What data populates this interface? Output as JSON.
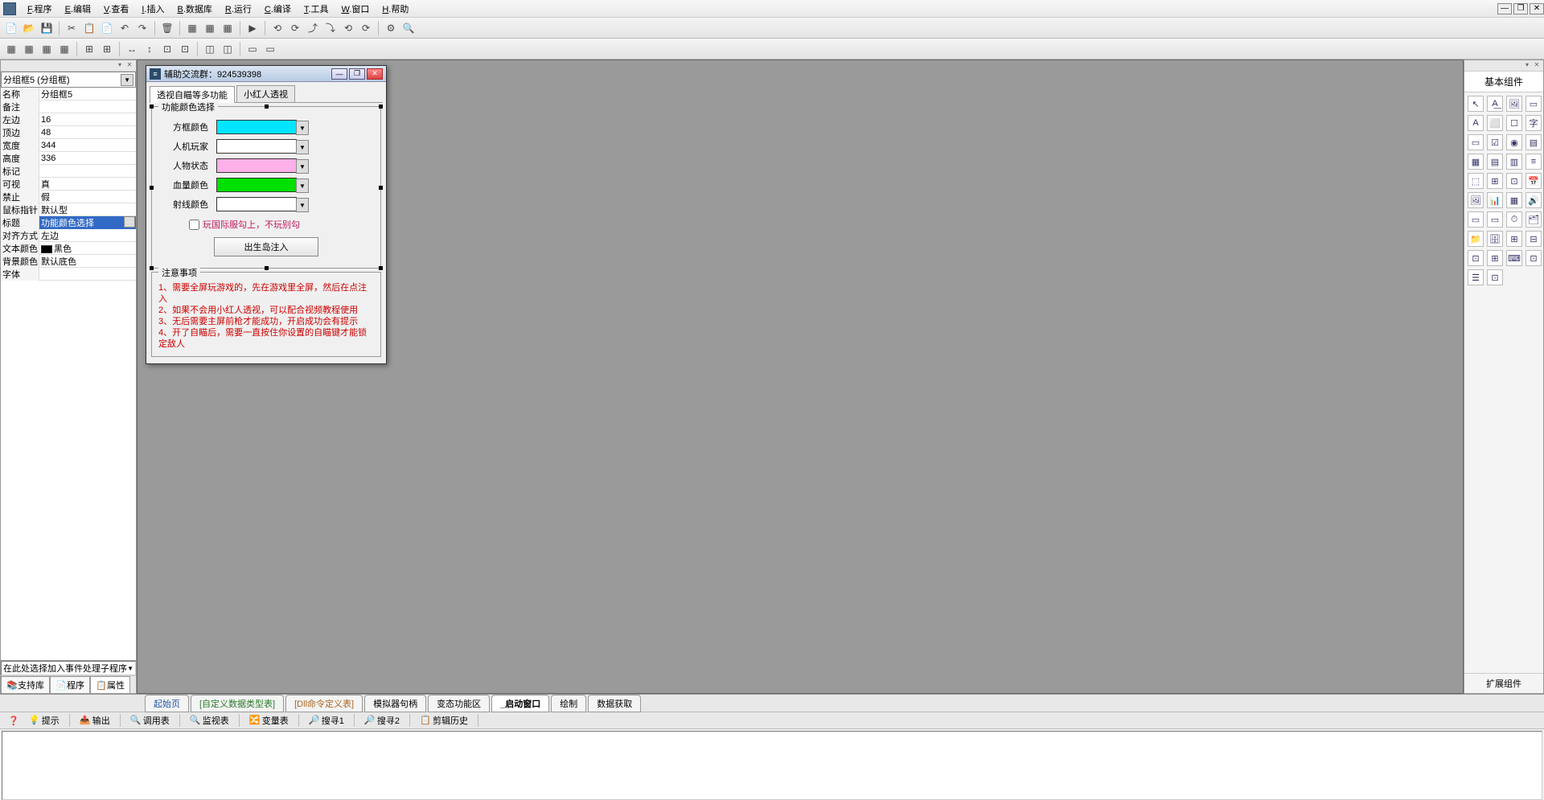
{
  "menu": {
    "items": [
      "F.程序",
      "E.编辑",
      "V.查看",
      "I.插入",
      "B.数据库",
      "R.运行",
      "C.编译",
      "T.工具",
      "W.窗口",
      "H.帮助"
    ]
  },
  "toolbar1_icons": [
    "📄",
    "📂",
    "💾",
    "",
    "✂",
    "📋",
    "📄",
    "↶",
    "↷",
    "",
    "🗑",
    "",
    "▦",
    "▦",
    "▦",
    "",
    "▶",
    "",
    "⟲",
    "⟳",
    "⤴",
    "⤵",
    "⟲",
    "⟳",
    "",
    "⚙",
    "🔍"
  ],
  "toolbar2_icons": [
    "▦",
    "▦",
    "▦",
    "▦",
    "",
    "⊞",
    "⊞",
    "",
    "↔",
    "↕",
    "⊡",
    "⊡",
    "",
    "◫",
    "◫",
    "",
    "▭",
    "▭"
  ],
  "left": {
    "selector": "分组框5 (分组框)",
    "props": [
      {
        "k": "名称",
        "v": "分组框5"
      },
      {
        "k": "备注",
        "v": ""
      },
      {
        "k": "左边",
        "v": "16"
      },
      {
        "k": "顶边",
        "v": "48"
      },
      {
        "k": "宽度",
        "v": "344"
      },
      {
        "k": "高度",
        "v": "336"
      },
      {
        "k": "标记",
        "v": ""
      },
      {
        "k": "可视",
        "v": "真"
      },
      {
        "k": "禁止",
        "v": "假"
      },
      {
        "k": "鼠标指针",
        "v": "默认型"
      },
      {
        "k": "标题",
        "v": "功能颜色选择",
        "sel": true,
        "dots": true
      },
      {
        "k": "对齐方式",
        "v": "左边"
      },
      {
        "k": "文本颜色",
        "v": "黑色",
        "color": "#000000"
      },
      {
        "k": "背景颜色",
        "v": "默认底色"
      },
      {
        "k": "字体",
        "v": ""
      }
    ],
    "event_combo": "在此处选择加入事件处理子程序",
    "tabs": [
      "支持库",
      "程序",
      "属性"
    ],
    "active_tab": 2
  },
  "form": {
    "title": "辅助交流群：924539398",
    "tab1": "透视自瞄等多功能",
    "tab2": "小红人透视",
    "group1_title": "功能颜色选择",
    "rows": [
      {
        "label": "方框颜色",
        "color": "#00e5ff"
      },
      {
        "label": "人机玩家",
        "color": "#ffffff"
      },
      {
        "label": "人物状态",
        "color": "#ffb0e8"
      },
      {
        "label": "血量颜色",
        "color": "#00e000"
      },
      {
        "label": "射线颜色",
        "color": "#ffffff"
      }
    ],
    "checkbox_label": "玩国际服勾上，不玩别勾",
    "inject_btn": "出生岛注入",
    "group2_title": "注意事项",
    "notes": [
      "1、需要全屏玩游戏的，先在游戏里全屏，然后在点注入",
      "2、如果不会用小红人透视，可以配合视频教程使用",
      "3、无后需要主屏前枪才能成功，开启成功会有提示",
      "4、开了自瞄后，需要一直按住你设置的自瞄键才能锁定敌人"
    ]
  },
  "right": {
    "title": "基本组件",
    "footer": "扩展组件"
  },
  "bottom_tabs": [
    {
      "label": "起始页",
      "cls": "col-blue"
    },
    {
      "label": "[自定义数据类型表]",
      "cls": "col-green"
    },
    {
      "label": "[Dll命令定义表]",
      "cls": "col-orange"
    },
    {
      "label": "模拟器句柄",
      "cls": ""
    },
    {
      "label": "变态功能区",
      "cls": ""
    },
    {
      "label": "_启动窗口",
      "cls": "active"
    },
    {
      "label": "绘制",
      "cls": ""
    },
    {
      "label": "数据获取",
      "cls": ""
    }
  ],
  "lower_tabs": [
    "提示",
    "输出",
    "调用表",
    "监视表",
    "变量表",
    "搜寻1",
    "搜寻2",
    "剪辑历史"
  ],
  "lower_icons": [
    "💡",
    "📤",
    "🔍",
    "🔍",
    "🔀",
    "🔎",
    "🔎",
    "📋"
  ]
}
